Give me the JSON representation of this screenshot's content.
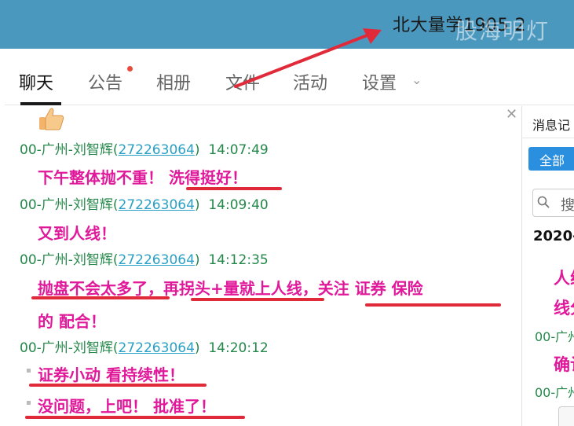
{
  "titlebar": {
    "group_title": "北大量学1905 2",
    "watermark": "股海明灯"
  },
  "tabs": [
    {
      "label": "聊天"
    },
    {
      "label": "公告"
    },
    {
      "label": "相册"
    },
    {
      "label": "文件"
    },
    {
      "label": "活动"
    },
    {
      "label": "设置"
    }
  ],
  "chat": {
    "messages": [
      {
        "sender": "00-广州-刘智辉(",
        "qq": "272263064",
        "sender_close": ")",
        "time": "14:07:49",
        "lines": [
          "下午整体抛不重！ 洗得挺好！"
        ]
      },
      {
        "sender": "00-广州-刘智辉(",
        "qq": "272263064",
        "sender_close": ")",
        "time": "14:09:40",
        "lines": [
          "又到人线！"
        ]
      },
      {
        "sender": "00-广州-刘智辉(",
        "qq": "272263064",
        "sender_close": ")",
        "time": "14:12:35",
        "lines": [
          "抛盘不会太多了，再拐头+量就上人线，关注 证券 保险",
          "的 配合！"
        ]
      },
      {
        "sender": "00-广州-刘智辉(",
        "qq": "272263064",
        "sender_close": ")",
        "time": "14:20:12",
        "lines": [
          "证券小动 看持续性！",
          "没问题，上吧！ 批准了！"
        ]
      }
    ]
  },
  "panel": {
    "title": "消息记",
    "all_button": "全部",
    "search_placeholder": "搜",
    "date": "2020-",
    "pink_1": "人线",
    "pink_2": "线分",
    "green_1": "00-广州",
    "pink_3": "确认",
    "green_2": "00-广州"
  },
  "colors": {
    "titlebar": "#4b98bf",
    "sender_green": "#24884a",
    "message_pink": "#e0189a",
    "annotation_red": "#e02a3a",
    "link_blue": "#2aa0c6",
    "button_blue": "#2b8fe0"
  },
  "icons": [
    "thumbs-up-icon",
    "close-icon",
    "chevron-down-icon",
    "search-icon"
  ]
}
